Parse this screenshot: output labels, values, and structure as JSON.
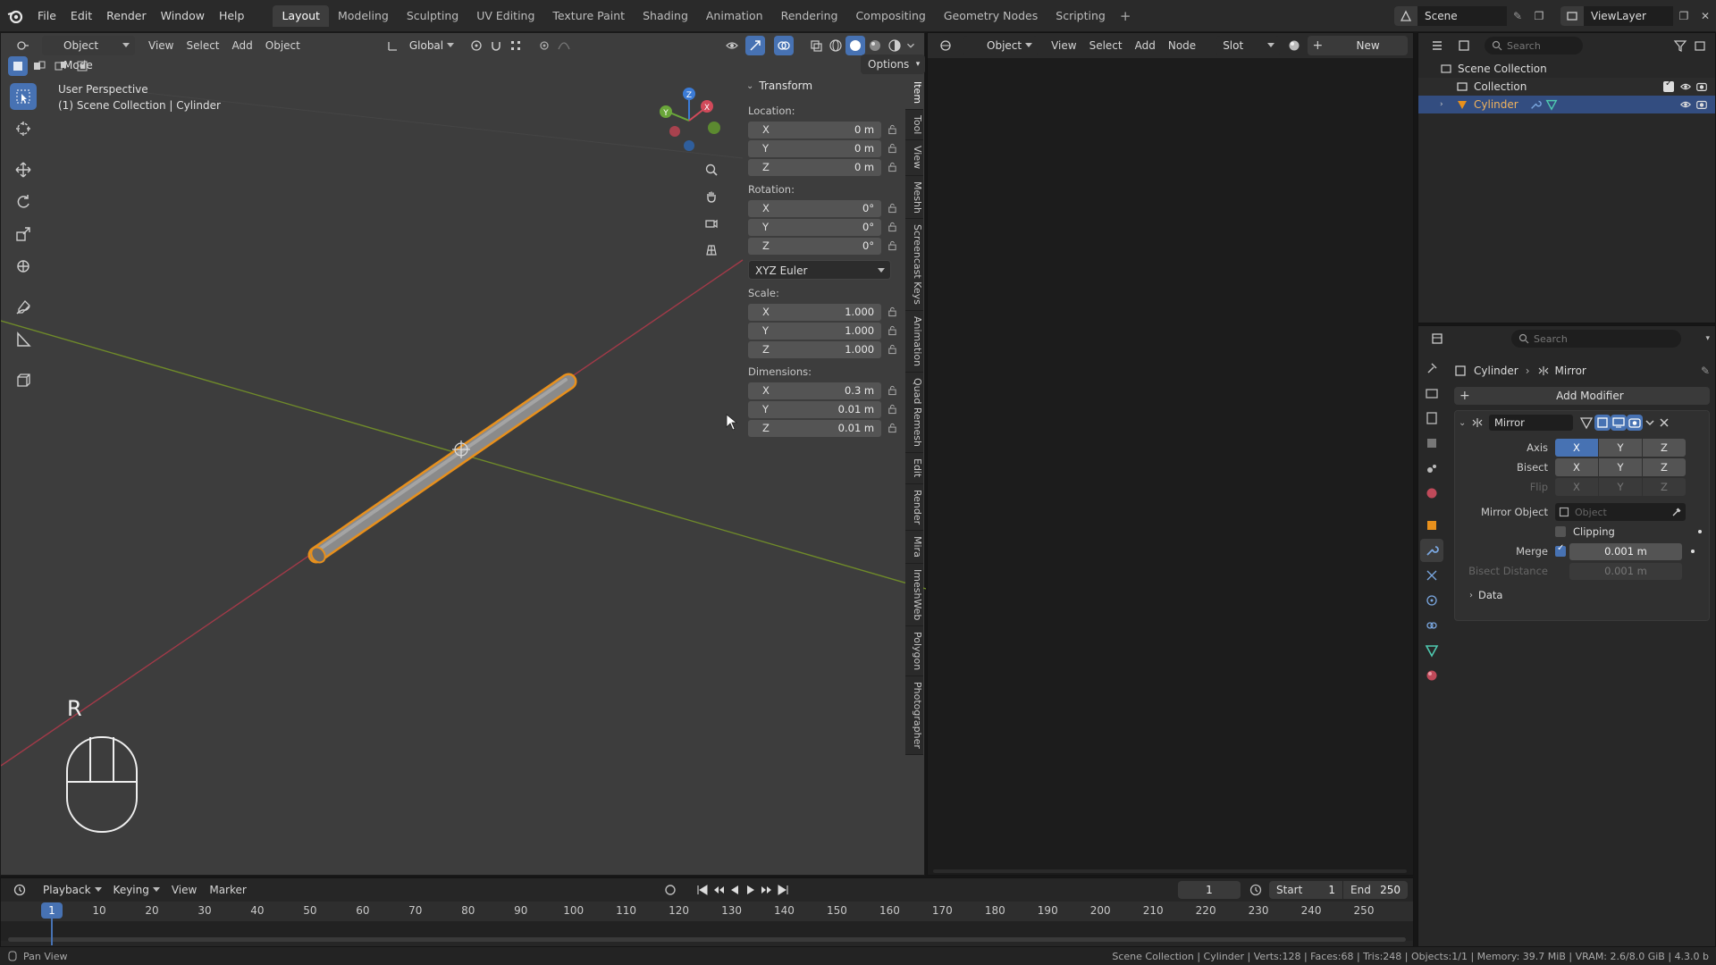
{
  "topbar": {
    "menus": [
      "File",
      "Edit",
      "Render",
      "Window",
      "Help"
    ],
    "workspaces": [
      "Layout",
      "Modeling",
      "Sculpting",
      "UV Editing",
      "Texture Paint",
      "Shading",
      "Animation",
      "Rendering",
      "Compositing",
      "Geometry Nodes",
      "Scripting"
    ],
    "active_workspace": "Layout",
    "scene": "Scene",
    "view_layer": "ViewLayer"
  },
  "viewport": {
    "mode": "Object Mode",
    "menus": [
      "View",
      "Select",
      "Add",
      "Object"
    ],
    "orientation": "Global",
    "options_label": "Options",
    "perspective": "User Perspective",
    "context": "(1) Scene Collection | Cylinder",
    "key_overlay": "R"
  },
  "npanel": {
    "title": "Transform",
    "location_label": "Location:",
    "location": [
      {
        "axis": "X",
        "value": "0 m"
      },
      {
        "axis": "Y",
        "value": "0 m"
      },
      {
        "axis": "Z",
        "value": "0 m"
      }
    ],
    "rotation_label": "Rotation:",
    "rotation": [
      {
        "axis": "X",
        "value": "0°"
      },
      {
        "axis": "Y",
        "value": "0°"
      },
      {
        "axis": "Z",
        "value": "0°"
      }
    ],
    "rotation_mode": "XYZ Euler",
    "scale_label": "Scale:",
    "scale": [
      {
        "axis": "X",
        "value": "1.000"
      },
      {
        "axis": "Y",
        "value": "1.000"
      },
      {
        "axis": "Z",
        "value": "1.000"
      }
    ],
    "dimensions_label": "Dimensions:",
    "dimensions": [
      {
        "axis": "X",
        "value": "0.3 m"
      },
      {
        "axis": "Y",
        "value": "0.01 m"
      },
      {
        "axis": "Z",
        "value": "0.01 m"
      }
    ],
    "tabs": [
      "Item",
      "Tool",
      "View",
      "Meshh",
      "Screencast Keys",
      "Animation",
      "Quad Remesh",
      "Edit",
      "Render",
      "Mira",
      "ImeshWeb",
      "Polygon",
      "Photographer"
    ]
  },
  "node_editor": {
    "type": "Object",
    "menus": [
      "View",
      "Select",
      "Add",
      "Node"
    ],
    "slot": "Slot",
    "new_label": "New"
  },
  "outliner": {
    "search_placeholder": "Search",
    "root": "Scene Collection",
    "collection": "Collection",
    "object": "Cylinder"
  },
  "properties": {
    "search_placeholder": "Search",
    "breadcrumb_object": "Cylinder",
    "breadcrumb_modifier": "Mirror",
    "add_modifier": "Add Modifier",
    "modifier_name": "Mirror",
    "axis_label": "Axis",
    "bisect_label": "Bisect",
    "flip_label": "Flip",
    "axes": [
      "X",
      "Y",
      "Z"
    ],
    "mirror_object_label": "Mirror Object",
    "mirror_object_placeholder": "Object",
    "clipping_label": "Clipping",
    "merge_label": "Merge",
    "merge_value": "0.001 m",
    "bisect_distance_label": "Bisect Distance",
    "bisect_distance_value": "0.001 m",
    "data_label": "Data"
  },
  "timeline": {
    "menus": [
      "Playback",
      "Keying",
      "View",
      "Marker"
    ],
    "current_frame": "1",
    "start_label": "Start",
    "start_value": "1",
    "end_label": "End",
    "end_value": "250",
    "ticks": [
      "1",
      "10",
      "20",
      "30",
      "40",
      "50",
      "60",
      "70",
      "80",
      "90",
      "100",
      "110",
      "120",
      "130",
      "140",
      "150",
      "160",
      "170",
      "180",
      "190",
      "200",
      "210",
      "220",
      "230",
      "240",
      "250"
    ]
  },
  "statusbar": {
    "left": "Pan View",
    "right": "Scene Collection | Cylinder | Verts:128 | Faces:68 | Tris:248 | Objects:1/1 | Memory: 39.7 MiB | VRAM: 2.6/8.0 GiB | 4.3.0 b"
  }
}
